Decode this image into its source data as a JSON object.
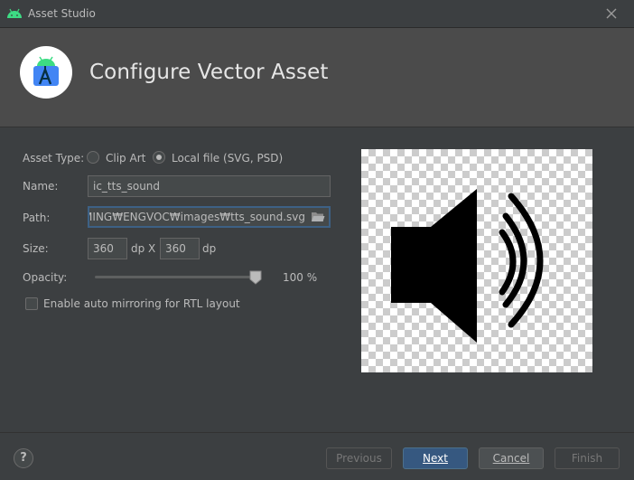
{
  "window": {
    "title": "Asset Studio"
  },
  "header": {
    "title": "Configure Vector Asset"
  },
  "form": {
    "asset_type_label": "Asset Type:",
    "asset_type_options": [
      "Clip Art",
      "Local file (SVG, PSD)"
    ],
    "asset_type_selected": "Local file (SVG, PSD)",
    "name_label": "Name:",
    "name_value": "ic_tts_sound",
    "path_label": "Path:",
    "path_value": "GRAMMING₩ENGVOC₩images₩tts_sound.svg",
    "size_label": "Size:",
    "width_value": "360",
    "height_value": "360",
    "size_unit": "dp",
    "size_separator": "X",
    "opacity_label": "Opacity:",
    "opacity_value": 100,
    "opacity_text": "100 %",
    "rtl_label": "Enable auto mirroring for RTL layout",
    "rtl_checked": false
  },
  "preview": {
    "icon": "volume-up-icon"
  },
  "footer": {
    "help_label": "?",
    "previous_label": "Previous",
    "next_label": "Next",
    "cancel_label": "Cancel",
    "finish_label": "Finish",
    "previous_enabled": false,
    "finish_enabled": false
  },
  "colors": {
    "background": "#3c3f41",
    "header_background": "#4b4b4b",
    "primary_button": "#365880",
    "android_green": "#3ddc84",
    "focus_border": "#3d6185"
  }
}
